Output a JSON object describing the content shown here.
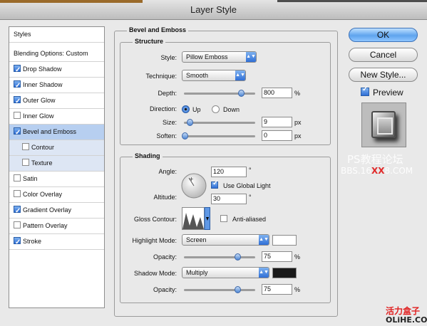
{
  "window": {
    "title": "Layer Style"
  },
  "styles_list": {
    "header": "Styles",
    "blending": "Blending Options: Custom",
    "items": [
      {
        "label": "Drop Shadow",
        "checked": true
      },
      {
        "label": "Inner Shadow",
        "checked": true
      },
      {
        "label": "Outer Glow",
        "checked": true
      },
      {
        "label": "Inner Glow",
        "checked": false
      },
      {
        "label": "Bevel and Emboss",
        "checked": true
      },
      {
        "label": "Contour",
        "checked": false
      },
      {
        "label": "Texture",
        "checked": false
      },
      {
        "label": "Satin",
        "checked": false
      },
      {
        "label": "Color Overlay",
        "checked": false
      },
      {
        "label": "Gradient Overlay",
        "checked": true
      },
      {
        "label": "Pattern Overlay",
        "checked": false
      },
      {
        "label": "Stroke",
        "checked": true
      }
    ]
  },
  "bevel": {
    "title": "Bevel and Emboss",
    "structure": {
      "title": "Structure",
      "style_label": "Style:",
      "style_value": "Pillow Emboss",
      "technique_label": "Technique:",
      "technique_value": "Smooth",
      "depth_label": "Depth:",
      "depth_value": "800",
      "depth_unit": "%",
      "direction_label": "Direction:",
      "direction_up": "Up",
      "direction_down": "Down",
      "size_label": "Size:",
      "size_value": "9",
      "size_unit": "px",
      "soften_label": "Soften:",
      "soften_value": "0",
      "soften_unit": "px"
    },
    "shading": {
      "title": "Shading",
      "angle_label": "Angle:",
      "angle_value": "120",
      "angle_unit": "°",
      "global_light_label": "Use Global Light",
      "altitude_label": "Altitude:",
      "altitude_value": "30",
      "altitude_unit": "°",
      "gloss_label": "Gloss Contour:",
      "anti_aliased_label": "Anti-aliased",
      "highlight_mode_label": "Highlight Mode:",
      "highlight_mode_value": "Screen",
      "highlight_color": "#ffffff",
      "highlight_opacity_label": "Opacity:",
      "highlight_opacity_value": "75",
      "highlight_opacity_unit": "%",
      "shadow_mode_label": "Shadow Mode:",
      "shadow_mode_value": "Multiply",
      "shadow_color": "#1a1a1a",
      "shadow_opacity_label": "Opacity:",
      "shadow_opacity_value": "75",
      "shadow_opacity_unit": "%"
    }
  },
  "buttons": {
    "ok": "OK",
    "cancel": "Cancel",
    "new_style": "New Style...",
    "preview": "Preview"
  },
  "watermarks": {
    "ps": "PS教程论坛",
    "bbs_a": "BBS.16",
    "bbs_xx": "XX",
    "bbs_b": "8.COM",
    "site_cn": "活力盒子",
    "site_en": "OLiHE.COM"
  }
}
